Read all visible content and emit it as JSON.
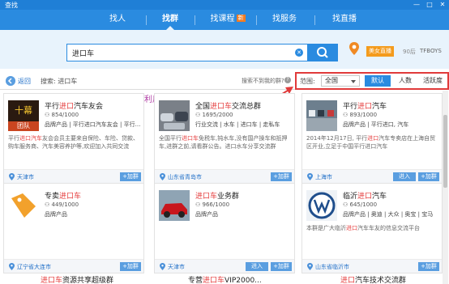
{
  "window": {
    "title": "查找",
    "controls": [
      "—",
      "□",
      "✕"
    ]
  },
  "nav": {
    "tabs": [
      {
        "label": "找人",
        "new": ""
      },
      {
        "label": "找群",
        "new": ""
      },
      {
        "label": "找课程",
        "new": "新"
      },
      {
        "label": "找服务",
        "new": ""
      },
      {
        "label": "找直播",
        "new": ""
      }
    ],
    "active_index": 1
  },
  "search": {
    "value": "进口车",
    "placeholder": ""
  },
  "user": {
    "live_badge": "美女直播",
    "level": "90后",
    "name": "TFBOYS"
  },
  "filter": {
    "back_label": "返回",
    "crumb": "搜索: 进口车",
    "not_found": "搜索不到我的群?",
    "help": "?",
    "range_label": "范围:",
    "range_value": "全国",
    "sort": [
      "默认",
      "人数",
      "活跃度"
    ],
    "sort_active": 0
  },
  "annotation": "可利用以上功能对群进行排列",
  "groups": [
    {
      "name_pre": "平行",
      "name_kw": "进口",
      "name_post": "汽车友会",
      "count": "854/1000",
      "tags": "品牌产品  |  平行进口汽车友会  |  平行...",
      "desc_pre": "平行",
      "desc_kw": "进口汽车",
      "desc_post": "友会会员主要来自保险、车险、贷款、购车服务商、汽车美容养护等,欢迎加入共同交流",
      "location": "天津市",
      "join": "+加群",
      "enter": "",
      "thumb": "fighter",
      "thumb_text": "十幕 团队"
    },
    {
      "name_pre": "全国",
      "name_kw": "进口车",
      "name_post": "交流总群",
      "count": "1695/2000",
      "tags": "行业交流  |  水车  |  进口车  |  走私车",
      "desc_pre": "全国平行",
      "desc_kw": "进口车",
      "desc_post": "免税车,钝水车,没有国产操车和抵押车,进群之前,请看群公告。进口水车分享交流群",
      "location": "山东省青岛市",
      "join": "+加群",
      "enter": "",
      "thumb": "cars",
      "thumb_text": ""
    },
    {
      "name_pre": "平行",
      "name_kw": "进口",
      "name_post": "汽车",
      "count": "893/1000",
      "tags": "品牌产品  |  平行进口, 汽车",
      "desc_pre": "2014年12月17日, 平行",
      "desc_kw": "进口",
      "desc_post": "汽车专卖店在上海自贸区开业,立足于中国平行进口汽车",
      "location": "上海市",
      "join": "+加群",
      "enter": "进入",
      "thumb": "lot",
      "thumb_text": ""
    },
    {
      "name_pre": "专卖",
      "name_kw": "进口车",
      "name_post": "",
      "count": "449/1000",
      "tags": "品牌产品",
      "desc_pre": "",
      "desc_kw": "",
      "desc_post": "",
      "location": "辽宁省大连市",
      "join": "+加群",
      "enter": "",
      "thumb": "tag",
      "thumb_text": ""
    },
    {
      "name_pre": "",
      "name_kw": "进口车",
      "name_post": "业务群",
      "count": "966/1000",
      "tags": "品牌产品",
      "desc_pre": "",
      "desc_kw": "",
      "desc_post": "",
      "location": "天津市",
      "join": "+加群",
      "enter": "进入",
      "thumb": "redcar",
      "thumb_text": ""
    },
    {
      "name_pre": "临沂",
      "name_kw": "进口",
      "name_post": "汽车",
      "count": "645/1000",
      "tags": "品牌产品  |  奥迪  |  大众  |  奥宝  |  宝马",
      "desc_pre": "本群是广大临沂",
      "desc_kw": "进口",
      "desc_post": "汽车车友的信息交流平台",
      "location": "山东省临沂市",
      "join": "+加群",
      "enter": "",
      "thumb": "vw",
      "thumb_text": ""
    }
  ],
  "partial_row": [
    {
      "name_pre": "",
      "name_kw": "进口车",
      "name_post": "资源共享超级群"
    },
    {
      "name_pre": "专营",
      "name_kw": "进口车",
      "name_post": "VIP2000..."
    },
    {
      "name_pre": "",
      "name_kw": "进口",
      "name_post": "汽车技术交流群"
    }
  ],
  "colors": {
    "nav": "#2a8be0",
    "keyword": "#e53c3c",
    "annotation": "#b03aa4",
    "highlight_box": "#e03a3a"
  }
}
